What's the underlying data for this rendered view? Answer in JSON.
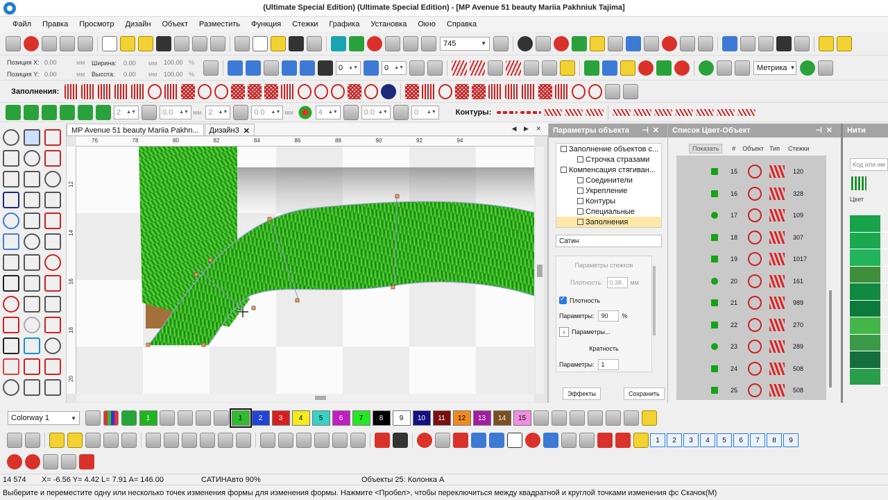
{
  "window": {
    "title": "(Ultimate Special Edition) (Ultimate Special Edition) - [MP Avenue 51 beauty Mariia Pakhniuk       Tajima]"
  },
  "menu": [
    "Файл",
    "Правка",
    "Просмотр",
    "Дизайн",
    "Объект",
    "Разместить",
    "Функция",
    "Стежки",
    "Графика",
    "Установка",
    "Окно",
    "Справка"
  ],
  "toolbar1": {
    "zoom_value": "745",
    "metric_label": "Метрика"
  },
  "position": {
    "pos_x_label": "Позиция X:",
    "pos_x_value": "0.00",
    "pos_y_label": "Позиция Y:",
    "pos_y_value": "0.00",
    "unit": "мм",
    "width_label": "Ширина:",
    "width_value": "0.00",
    "height_label": "Высота:",
    "height_value": "0.00",
    "pct_w": "100.00",
    "pct_h": "100.00",
    "pct_unit": "%"
  },
  "toolbar2": {
    "spin_a": "0",
    "spin_b": "0"
  },
  "fills_label": "Заполнения:",
  "toolbar4": {
    "spin1": "2",
    "spin2": "0.0",
    "spin3": "2",
    "spin4": "0.0",
    "spin5": "4",
    "spin6": "0.0",
    "spin7": "0",
    "unit_mm": "мм",
    "contours_label": "Контуры:"
  },
  "doc_tabs": [
    {
      "label": "MP Avenue 51 beauty Mariia Pakhn..."
    },
    {
      "label": "Дизайн3"
    }
  ],
  "rulers": {
    "top": [
      "76",
      "78",
      "80",
      "82",
      "84",
      "86",
      "88",
      "90",
      "92",
      "94"
    ],
    "left": [
      "12",
      "14",
      "16",
      "18",
      "20"
    ]
  },
  "params_panel": {
    "title": "Параметры объекта",
    "tree": [
      "Заполнение объектов с...",
      "Строчка стразами",
      "Компенсация стягиван...",
      "Соединители",
      "Укрепление",
      "Контуры",
      "Специальные",
      "Заполнения"
    ],
    "fill_type": "Сатин",
    "stitch_params_label": "Параметры стежков",
    "density_label": "Плотность:",
    "density_value": "0.38",
    "density_unit": "мм",
    "density_check_label": "Плотность",
    "params_label": "Параметры:",
    "params_value": "90",
    "params_unit": "%",
    "params_button": "Параметры...",
    "multiplicity_label": "Кратность",
    "params2_label": "Параметры:",
    "params2_value": "1",
    "effects_button": "Эффекты",
    "save_button": "Сохранить"
  },
  "color_object_panel": {
    "title": "Список Цвет-Объект",
    "show_label": "Показать",
    "headers": [
      "#",
      "Объект",
      "Тип",
      "Стежки"
    ],
    "rows": [
      {
        "num": "15",
        "stitches": "120"
      },
      {
        "num": "16",
        "stitches": "328"
      },
      {
        "num": "17",
        "stitches": "109"
      },
      {
        "num": "18",
        "stitches": "307"
      },
      {
        "num": "19",
        "stitches": "1017"
      },
      {
        "num": "20",
        "stitches": "161"
      },
      {
        "num": "21",
        "stitches": "989"
      },
      {
        "num": "22",
        "stitches": "270"
      },
      {
        "num": "23",
        "stitches": "289"
      },
      {
        "num": "24",
        "stitches": "508"
      },
      {
        "num": "25",
        "stitches": "508"
      }
    ]
  },
  "threads_panel": {
    "title": "Нити",
    "search_placeholder": "Код или им",
    "color_header": "Цвет",
    "swatches": [
      "#16a34a",
      "#1aa84f",
      "#22b35b",
      "#3f8f3a",
      "#0f8a40",
      "#0b7a3a",
      "#44b649",
      "#3a9a47",
      "#156e3e",
      "#2a9d4a"
    ]
  },
  "colorway": "Colorway 1",
  "palette": [
    {
      "n": "1",
      "color": "#1fb51f",
      "text": "#ffffff"
    },
    {
      "n": "1",
      "color": "#2fbd2f",
      "text": "#000000"
    },
    {
      "n": "2",
      "color": "#1f44d6",
      "text": "#ffffff"
    },
    {
      "n": "3",
      "color": "#d62020",
      "text": "#ffffff"
    },
    {
      "n": "4",
      "color": "#f5ea1a",
      "text": "#000000"
    },
    {
      "n": "5",
      "color": "#3ad0c4",
      "text": "#000000"
    },
    {
      "n": "6",
      "color": "#c21fc2",
      "text": "#ffffff"
    },
    {
      "n": "7",
      "color": "#25e825",
      "text": "#000000"
    },
    {
      "n": "8",
      "color": "#000000",
      "text": "#ffffff"
    },
    {
      "n": "9",
      "color": "#ffffff",
      "text": "#000000"
    },
    {
      "n": "10",
      "color": "#101080",
      "text": "#ffffff"
    },
    {
      "n": "11",
      "color": "#7a1010",
      "text": "#ffffff"
    },
    {
      "n": "12",
      "color": "#ef8a1e",
      "text": "#000000"
    },
    {
      "n": "13",
      "color": "#a01ea0",
      "text": "#ffffff"
    },
    {
      "n": "14",
      "color": "#7a5020",
      "text": "#ffffff"
    },
    {
      "n": "15",
      "color": "#f28ee0",
      "text": "#000000"
    }
  ],
  "sequence_numbers": [
    "1",
    "2",
    "3",
    "4",
    "5",
    "6",
    "7",
    "8",
    "9"
  ],
  "status": {
    "stitch_count": "14 574",
    "coords": "X=  -6.56 Y=   4.42 L=   7.91 A= 146.00",
    "mode": "САТИНАвто 90%",
    "objects": "Объекты 25: Колонка А",
    "hint": "Выберите и переместите одну или несколько точек изменения формы для изменения формы. Нажмите <Пробел>, чтобы переключиться между квадратной и круглой точками изменения фс  Скачок(М)"
  },
  "accent_colors": {
    "embroidery_green": "#2fae1f",
    "panel_header": "#a4a4a4",
    "selection": "#fde8a8"
  }
}
